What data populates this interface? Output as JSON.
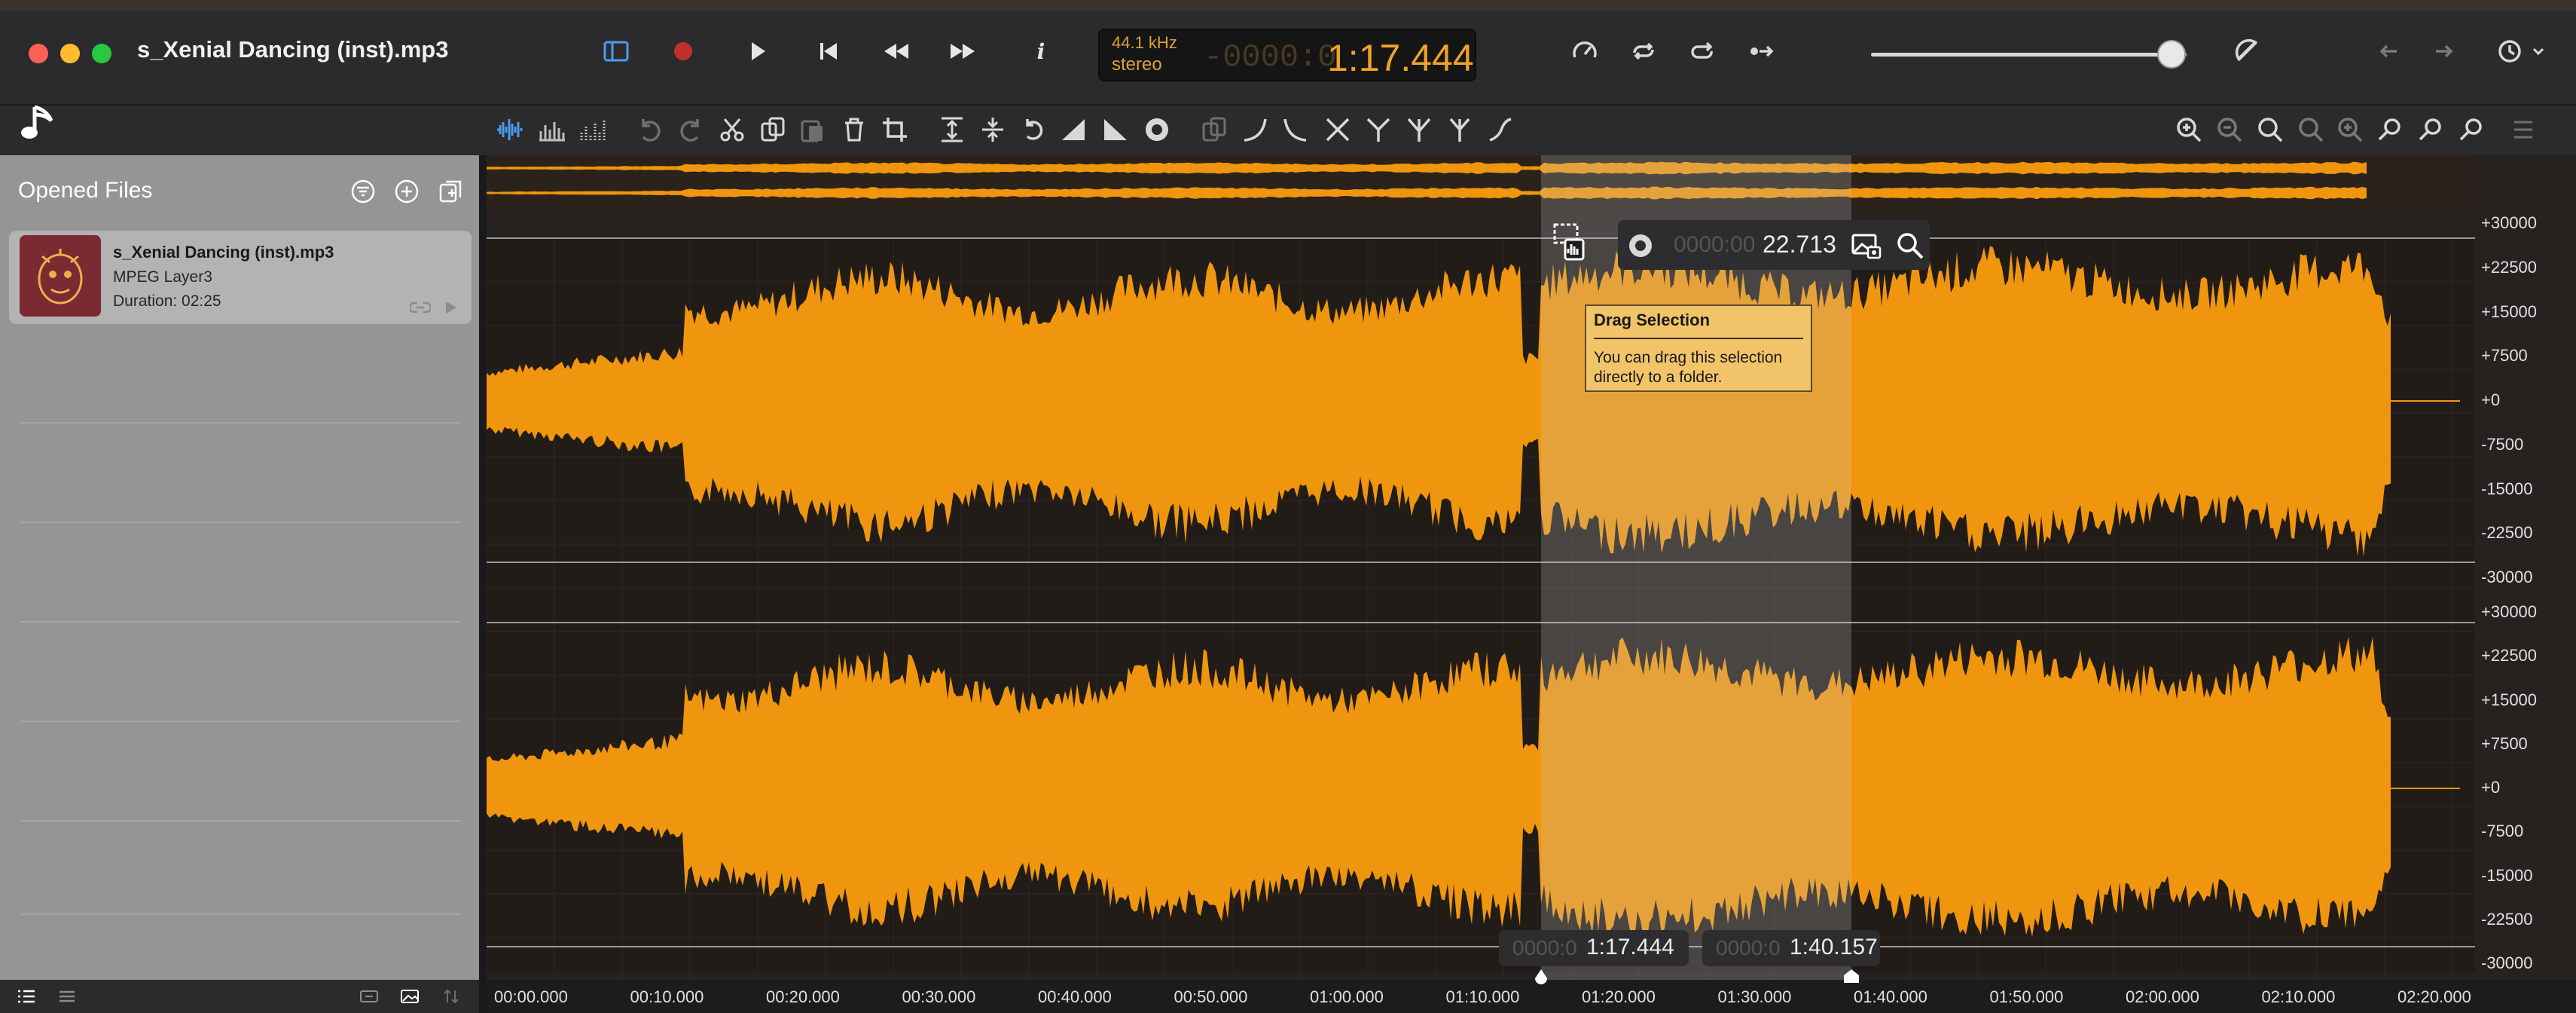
{
  "window": {
    "file_title": "s_Xenial Dancing (inst).mp3"
  },
  "transport": {
    "sample_rate": "44.1 kHz",
    "channels": "stereo",
    "time_dim": "-0000:0",
    "time_value": "1:17.444",
    "volume_level": 0.95
  },
  "sidebar": {
    "title": "Opened Files",
    "file": {
      "name": "s_Xenial Dancing (inst).mp3",
      "format": "MPEG Layer3",
      "duration": "Duration: 02:25"
    }
  },
  "selection": {
    "duration_dim": "0000:00",
    "duration": "22.713",
    "start_dim": "0000:0",
    "start": "1:17.444",
    "end_dim": "0000:0",
    "end": "1:40.157"
  },
  "tooltip": {
    "title": "Drag Selection",
    "body": "You can drag this selection directly to a folder."
  },
  "y_scale": {
    "top_channel": [
      "+30000",
      "+22500",
      "+15000",
      "+7500",
      "+0",
      "-7500",
      "-15000",
      "-22500",
      "-30000"
    ],
    "bottom_channel": [
      "+30000",
      "+22500",
      "+15000",
      "+7500",
      "+0",
      "-7500",
      "-15000",
      "-22500",
      "-30000"
    ]
  },
  "time_ruler": [
    "00:00.000",
    "00:10.000",
    "00:20.000",
    "00:30.000",
    "00:40.000",
    "00:50.000",
    "01:00.000",
    "01:10.000",
    "01:20.000",
    "01:30.000",
    "01:40.000",
    "01:50.000",
    "02:00.000",
    "02:10.000",
    "02:20.000"
  ],
  "colors": {
    "waveform": "#f0960e",
    "accent_time": "#f0a326",
    "record": "#c0302b"
  }
}
